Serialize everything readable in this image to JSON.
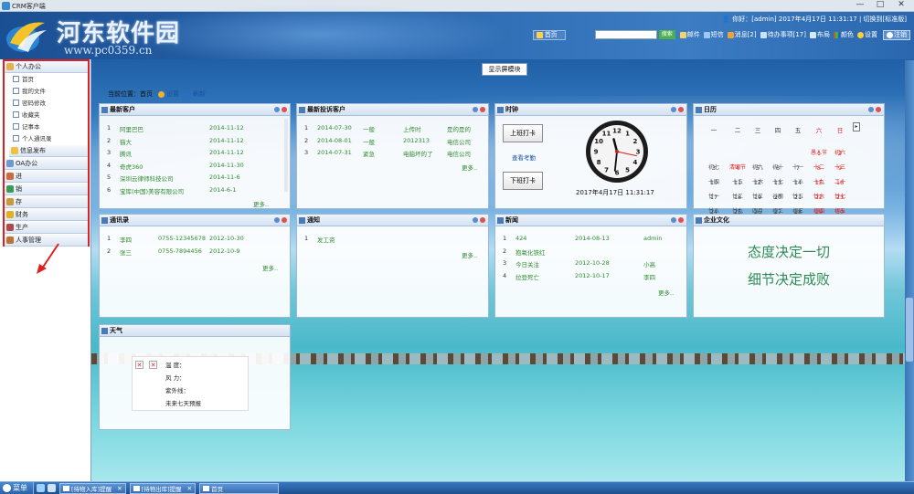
{
  "window": {
    "title": "CRM客户端",
    "minimize": "—",
    "maximize": "□",
    "close": "✕"
  },
  "header": {
    "brand": "河东软件园",
    "brand_url": "www.pc0359.cn",
    "user_info": "你好：[admin]  2017年4月17日  11:31:17  |  切换到[标准版]",
    "nav": {
      "home": "首页",
      "search_button": "搜索",
      "mail": "邮件",
      "sms": "短信",
      "message": "消息[2]",
      "todo": "待办事项[17]",
      "layout": "布局",
      "color": "颜色",
      "settings": "设置",
      "logout": "注销"
    }
  },
  "sidebar": {
    "groups": [
      {
        "label": "个人办公"
      },
      {
        "label": "信息发布"
      },
      {
        "label": "OA办公"
      },
      {
        "label": "进"
      },
      {
        "label": "销"
      },
      {
        "label": "存"
      },
      {
        "label": "财务"
      },
      {
        "label": "生产"
      },
      {
        "label": "人事管理"
      }
    ],
    "sub_items": [
      {
        "label": "首页"
      },
      {
        "label": "我的文件"
      },
      {
        "label": "密码修改"
      },
      {
        "label": "收藏夹"
      },
      {
        "label": "记事本"
      },
      {
        "label": "个人通讯录"
      }
    ]
  },
  "toolbar": {
    "show_module": "显示屏模块"
  },
  "location": {
    "label": "当前位置：首页",
    "settings": "设置",
    "refresh": "刷新"
  },
  "panels": {
    "new_customers": {
      "title": "最新客户",
      "rows": [
        {
          "no": "1",
          "name": "阿里巴巴",
          "date": "2014-11-12"
        },
        {
          "no": "2",
          "name": "猫大",
          "date": "2014-11-12"
        },
        {
          "no": "3",
          "name": "腾讯",
          "date": "2014-11-12"
        },
        {
          "no": "4",
          "name": "奇虎360",
          "date": "2014-11-30"
        },
        {
          "no": "5",
          "name": "深圳云律师科技公司",
          "date": "2014-11-6"
        },
        {
          "no": "6",
          "name": "宝库(中国)美容有限公司",
          "date": "2014-6-1"
        }
      ],
      "more": "更多.."
    },
    "complaints": {
      "title": "最新投诉客户",
      "rows": [
        {
          "no": "1",
          "date": "2014-07-30",
          "level": "一般",
          "subject": "上传时",
          "company": "是的是的"
        },
        {
          "no": "2",
          "date": "2014-08-01",
          "level": "一般",
          "subject": "2012313",
          "company": "电信公司"
        },
        {
          "no": "3",
          "date": "2014-07-31",
          "level": "紧急",
          "subject": "电脑坏的了",
          "company": "电信公司"
        }
      ],
      "more": "更多.."
    },
    "clock": {
      "title": "时钟",
      "clock_in": "上班打卡",
      "view_attendance": "查看考勤",
      "clock_out": "下班打卡",
      "datetime": "2017年4月17日  11:31:17",
      "time": {
        "hour": 11,
        "minute": 31,
        "second": 17
      },
      "numerals": [
        "12",
        "1",
        "2",
        "3",
        "4",
        "5",
        "6",
        "7",
        "8",
        "9",
        "10",
        "11"
      ]
    },
    "calendar": {
      "title": "日历",
      "weekdays": [
        "一",
        "二",
        "三",
        "四",
        "五",
        "六",
        "日"
      ],
      "weeks": [
        [
          {
            "d": "",
            "l": ""
          },
          {
            "d": "",
            "l": ""
          },
          {
            "d": "",
            "l": ""
          },
          {
            "d": "",
            "l": ""
          },
          {
            "d": "",
            "l": ""
          },
          {
            "d": "1",
            "l": "愚人节",
            "red": true
          },
          {
            "d": "2",
            "l": "初六",
            "red": true
          }
        ],
        [
          {
            "d": "3",
            "l": "初七"
          },
          {
            "d": "4",
            "l": "清明节",
            "red": true
          },
          {
            "d": "5",
            "l": "初九"
          },
          {
            "d": "6",
            "l": "初十"
          },
          {
            "d": "7",
            "l": "十一"
          },
          {
            "d": "8",
            "l": "十二",
            "red": true
          },
          {
            "d": "9",
            "l": "十三",
            "red": true
          }
        ],
        [
          {
            "d": "10",
            "l": "十四"
          },
          {
            "d": "11",
            "l": "十五"
          },
          {
            "d": "12",
            "l": "十六"
          },
          {
            "d": "13",
            "l": "十七"
          },
          {
            "d": "14",
            "l": "十八"
          },
          {
            "d": "15",
            "l": "十九",
            "red": true
          },
          {
            "d": "16",
            "l": "二十",
            "red": true
          }
        ],
        [
          {
            "d": "17",
            "l": "廿一",
            "today": true
          },
          {
            "d": "18",
            "l": "廿二"
          },
          {
            "d": "19",
            "l": "廿三"
          },
          {
            "d": "20",
            "l": "谷雨"
          },
          {
            "d": "21",
            "l": "廿五"
          },
          {
            "d": "22",
            "l": "廿六",
            "red": true
          },
          {
            "d": "23",
            "l": "廿七",
            "red": true
          }
        ],
        [
          {
            "d": "24",
            "l": "廿八"
          },
          {
            "d": "25",
            "l": "廿九"
          },
          {
            "d": "26",
            "l": "四月"
          },
          {
            "d": "27",
            "l": "初二"
          },
          {
            "d": "28",
            "l": "初三"
          },
          {
            "d": "29",
            "l": "初四",
            "red": true
          },
          {
            "d": "30",
            "l": "初五",
            "red": true
          }
        ]
      ]
    },
    "contacts": {
      "title": "通讯录",
      "rows": [
        {
          "no": "1",
          "name": "李四",
          "phone": "0755-12345678",
          "date": "2012-10-30"
        },
        {
          "no": "2",
          "name": "张三",
          "phone": "0755-7894456",
          "date": "2012-10-9"
        }
      ],
      "more": "更多.."
    },
    "notice": {
      "title": "通知",
      "rows": [
        {
          "no": "1",
          "title": "发工资"
        }
      ],
      "more": "更多.."
    },
    "news": {
      "title": "新闻",
      "rows": [
        {
          "no": "1",
          "title": "424",
          "date": "2014-08-13",
          "author": "admin"
        },
        {
          "no": "2",
          "title": "抱氧化铁红",
          "date": "",
          "author": ""
        },
        {
          "no": "3",
          "title": "今日关注",
          "date": "2012-10-28",
          "author": "小高"
        },
        {
          "no": "4",
          "title": "拉登死亡",
          "date": "2012-10-17",
          "author": "李四"
        }
      ],
      "more": "更多.."
    },
    "culture": {
      "title": "企业文化",
      "line1": "态度决定一切",
      "line2": "细节决定成败"
    },
    "weather": {
      "title": "天气",
      "temperature": "温  度：",
      "wind": "风  力：",
      "uv": "紫外线：",
      "forecast": "未来七天预报"
    }
  },
  "taskbar": {
    "start": "菜单",
    "tasks": [
      {
        "label": "[待物入库]提醒"
      },
      {
        "label": "[待物出库]提醒"
      },
      {
        "label": "首页"
      }
    ]
  }
}
